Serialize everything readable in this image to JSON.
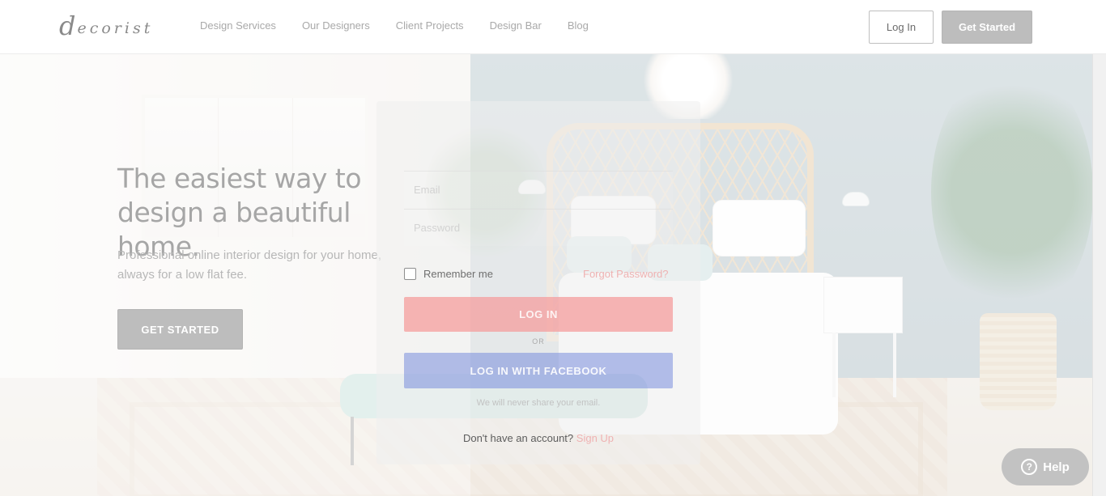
{
  "header": {
    "logo_initial": "d",
    "logo_rest": "ecorist",
    "nav": [
      {
        "label": "Design Services"
      },
      {
        "label": "Our Designers"
      },
      {
        "label": "Client Projects"
      },
      {
        "label": "Design Bar"
      },
      {
        "label": "Blog"
      }
    ],
    "login_label": "Log In",
    "get_started_label": "Get Started"
  },
  "hero": {
    "headline": "The easiest way to design a beautiful home.",
    "subline": "Professional online interior design for your home, always for a low flat fee.",
    "cta_label": "GET STARTED"
  },
  "login_form": {
    "email_placeholder": "Email",
    "password_placeholder": "Password",
    "remember_label": "Remember me",
    "forgot_label": "Forgot Password?",
    "login_button": "LOG IN",
    "or_label": "OR",
    "facebook_button": "LOG IN WITH FACEBOOK",
    "privacy_note": "We will never share your email.",
    "no_account_text": "Don't have an account?",
    "signup_link": "Sign Up"
  },
  "help": {
    "label": "Help",
    "icon": "question-circle-icon"
  },
  "colors": {
    "login_button": "#f5a0a0",
    "facebook_button": "#788cdc",
    "accent_link": "#efb2b2",
    "header_cta": "#bdbdbd"
  }
}
